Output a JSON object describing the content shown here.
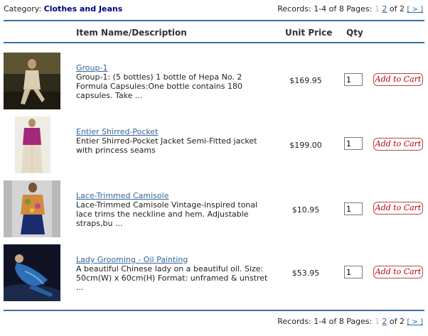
{
  "category": {
    "label": "Category:",
    "value": "Clothes and Jeans"
  },
  "pager_top": {
    "records": "Records: 1-4 of 8",
    "pages_label": "Pages:",
    "page1": "1",
    "page2": "2",
    "of_total": "of 2",
    "next": "[ > ]"
  },
  "pager_bottom": {
    "records": "Records: 1-4 of 8",
    "pages_label": "Pages:",
    "page1": "1",
    "page2": "2",
    "of_total": "of 2",
    "next": "[ > ]"
  },
  "columns": {
    "name": "Item Name/Description",
    "price": "Unit Price",
    "qty": "Qty"
  },
  "add_label": "Add to Cart",
  "products": [
    {
      "title": "Group-1",
      "description": "Group-1: (5 bottles) 1 bottle of Hepa No. 2 Formula Capsules:One bottle contains 180 capsules. Take ...",
      "price": "$169.95",
      "qty": "1"
    },
    {
      "title": "Entier Shirred-Pocket",
      "description": "Entier Shirred-Pocket Jacket Semi-Fitted jacket with princess seams",
      "price": "$199.00",
      "qty": "1"
    },
    {
      "title": "Lace-Trimmed Camisole",
      "description": "Lace-Trimmed Camisole Vintage-inspired tonal lace trims the neckline and hem. Adjustable straps,bu ...",
      "price": "$10.95",
      "qty": "1"
    },
    {
      "title": "Lady Grooming - Oil Painting",
      "description": "A beautiful Chinese lady on a beautiful oil. Size: 50cm(W) x 60cm(H) Format: unframed & unstret ...",
      "price": "$53.95",
      "qty": "1"
    }
  ]
}
